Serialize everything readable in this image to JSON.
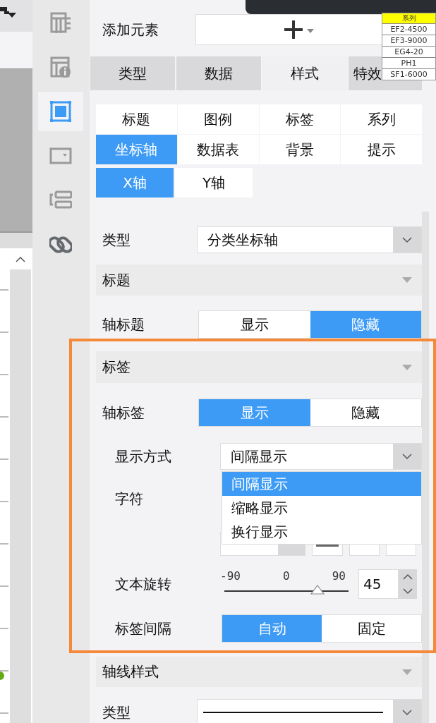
{
  "icon_bar": {
    "items": [
      {
        "kind": "table-header",
        "selected": false
      },
      {
        "kind": "table-info",
        "selected": false
      },
      {
        "kind": "frame",
        "selected": true
      },
      {
        "kind": "dropdown",
        "selected": false
      },
      {
        "kind": "layout",
        "selected": false
      },
      {
        "kind": "link",
        "selected": false
      }
    ]
  },
  "add_element": {
    "label": "添加元素"
  },
  "tabs": [
    {
      "label": "类型",
      "selected": false
    },
    {
      "label": "数据",
      "selected": false
    },
    {
      "label": "样式",
      "selected": true
    },
    {
      "label": "特效",
      "selected": false
    }
  ],
  "style_tabs": [
    {
      "label": "标题",
      "selected": false
    },
    {
      "label": "图例",
      "selected": false
    },
    {
      "label": "标签",
      "selected": false
    },
    {
      "label": "系列",
      "selected": false
    },
    {
      "label": "坐标轴",
      "selected": true
    },
    {
      "label": "数据表",
      "selected": false
    },
    {
      "label": "背景",
      "selected": false
    },
    {
      "label": "提示",
      "selected": false
    }
  ],
  "axis_tabs": [
    {
      "label": "X轴",
      "selected": true
    },
    {
      "label": "Y轴",
      "selected": false
    }
  ],
  "axis_type": {
    "label": "类型",
    "value": "分类坐标轴"
  },
  "sections": [
    {
      "title": "标题",
      "highlighted": false,
      "rows": [
        {
          "kind": "toggle",
          "label": "轴标题",
          "options": [
            {
              "label": "显示",
              "selected": false
            },
            {
              "label": "隐藏",
              "selected": true
            }
          ]
        }
      ]
    },
    {
      "title": "标签",
      "highlighted": true,
      "rows": [
        {
          "kind": "toggle",
          "label": "轴标签",
          "options": [
            {
              "label": "显示",
              "selected": true
            },
            {
              "label": "隐藏",
              "selected": false
            }
          ],
          "children": [
            {
              "kind": "select",
              "label": "显示方式",
              "value": "间隔显示",
              "expanded": true,
              "options": [
                {
                  "label": "间隔显示",
                  "selected": true
                },
                {
                  "label": "缩略显示",
                  "selected": false
                },
                {
                  "label": "换行显示",
                  "selected": false
                }
              ]
            },
            {
              "kind": "font",
              "label": "字符"
            },
            {
              "kind": "slider",
              "label": "文本旋转",
              "ticks": [
                "-90",
                "0",
                "90"
              ],
              "level": 0.75,
              "value": "45"
            },
            {
              "kind": "toggle",
              "label": "标签间隔",
              "options": [
                {
                  "label": "自动",
                  "selected": true
                },
                {
                  "label": "固定",
                  "selected": false
                }
              ]
            }
          ]
        }
      ]
    },
    {
      "title": "轴线样式",
      "highlighted": false,
      "rows": [
        {
          "kind": "line-select",
          "label": "类型"
        }
      ]
    }
  ],
  "legend": {
    "title": "系列",
    "items": [
      "EF2-4500",
      "EF3-9000",
      "EG4-20",
      "PH1",
      "SF1-6000"
    ]
  }
}
